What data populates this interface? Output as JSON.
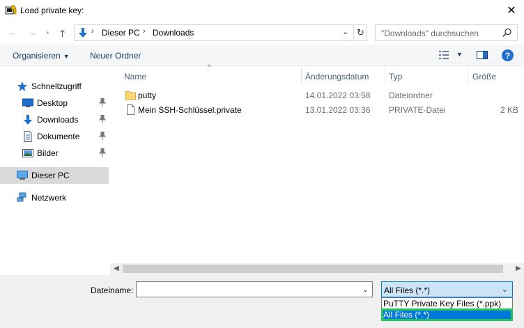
{
  "window": {
    "title": "Load private key:"
  },
  "nav": {
    "crumbs": [
      "Dieser PC",
      "Downloads"
    ],
    "search_placeholder": "\"Downloads\" durchsuchen"
  },
  "toolbar": {
    "organize_label": "Organisieren",
    "new_folder_label": "Neuer Ordner"
  },
  "sidebar": {
    "items": [
      {
        "label": "Schnellzugriff",
        "icon": "star-icon"
      },
      {
        "label": "Desktop",
        "icon": "desktop-icon",
        "pinned": true
      },
      {
        "label": "Downloads",
        "icon": "download-arrow-icon",
        "pinned": true
      },
      {
        "label": "Dokumente",
        "icon": "document-icon",
        "pinned": true
      },
      {
        "label": "Bilder",
        "icon": "pictures-icon",
        "pinned": true
      },
      {
        "label": "Dieser PC",
        "icon": "computer-icon",
        "selected": true
      },
      {
        "label": "Netzwerk",
        "icon": "network-icon"
      }
    ]
  },
  "filelist": {
    "columns": [
      "Name",
      "Änderungsdatum",
      "Typ",
      "Größe"
    ],
    "rows": [
      {
        "name": "putty",
        "date": "14.01.2022 03:58",
        "type": "Dateiordner",
        "size": "",
        "icon": "folder-icon"
      },
      {
        "name": "Mein SSH-Schlüssel.private",
        "date": "13.01.2022 03:36",
        "type": "PRIVATE-Datei",
        "size": "2 KB",
        "icon": "file-icon"
      }
    ]
  },
  "footer": {
    "filename_label": "Dateiname:",
    "filename_value": "",
    "filetype_selected": "All Files (*.*)",
    "filetype_options": [
      "PuTTY Private Key Files (*.ppk)",
      "All Files (*.*)"
    ]
  },
  "colors": {
    "accent": "#0078d7",
    "highlight_outline": "#22c55e",
    "selected_sidebar": "#d9d9d9"
  }
}
